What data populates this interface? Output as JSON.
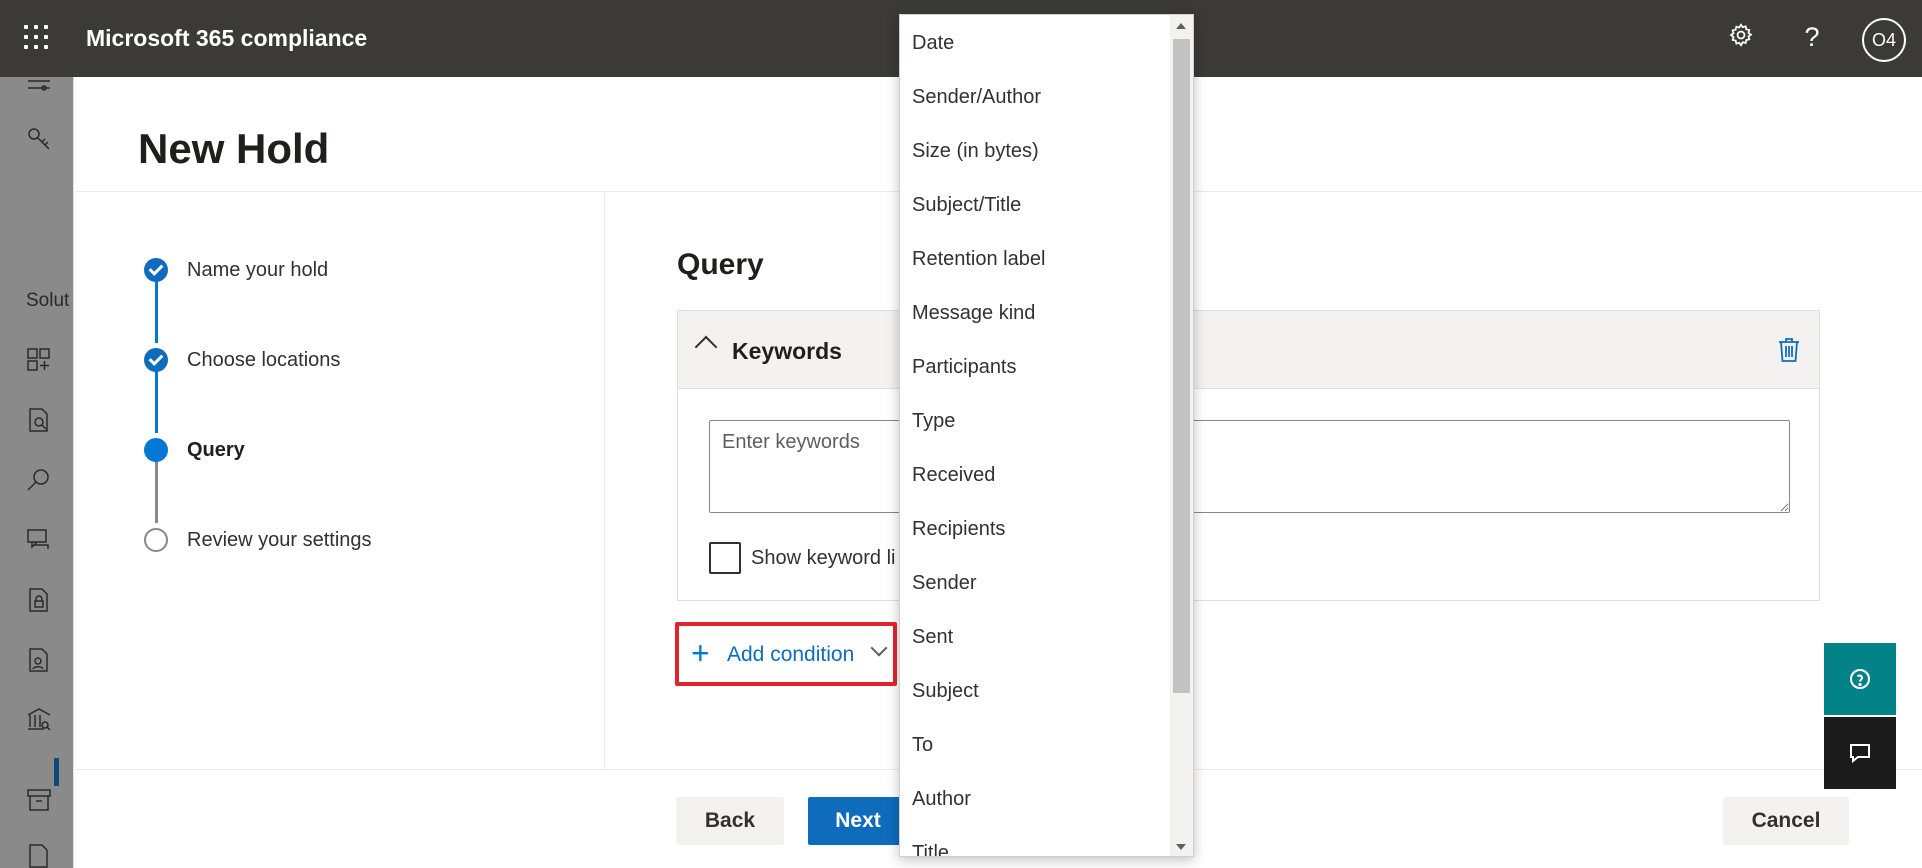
{
  "app": {
    "title": "Microsoft 365 compliance",
    "avatar_initials": "O4"
  },
  "top_icons": [
    "waffle-icon",
    "gear-icon",
    "help-icon"
  ],
  "rail": {
    "partial_label": "Solut"
  },
  "panel": {
    "title": "New Hold"
  },
  "steps": [
    {
      "label": "Name your hold",
      "state": "done"
    },
    {
      "label": "Choose locations",
      "state": "done"
    },
    {
      "label": "Query",
      "state": "current"
    },
    {
      "label": "Review your settings",
      "state": "todo"
    }
  ],
  "query": {
    "title": "Query",
    "keywords_title": "Keywords",
    "keywords_placeholder": "Enter keywords",
    "show_keyword_list_label": "Show keyword li",
    "add_condition_label": "Add condition"
  },
  "buttons": {
    "back": "Back",
    "next": "Next",
    "cancel": "Cancel"
  },
  "dropdown": {
    "items": [
      "Date",
      "Sender/Author",
      "Size (in bytes)",
      "Subject/Title",
      "Retention label",
      "Message kind",
      "Participants",
      "Type",
      "Received",
      "Recipients",
      "Sender",
      "Sent",
      "Subject",
      "To",
      "Author",
      "Title"
    ]
  },
  "colors": {
    "accent": "#0f6cbd",
    "topbar": "#3b3a39",
    "highlight": "#e0252f",
    "help_teal": "#038387"
  }
}
